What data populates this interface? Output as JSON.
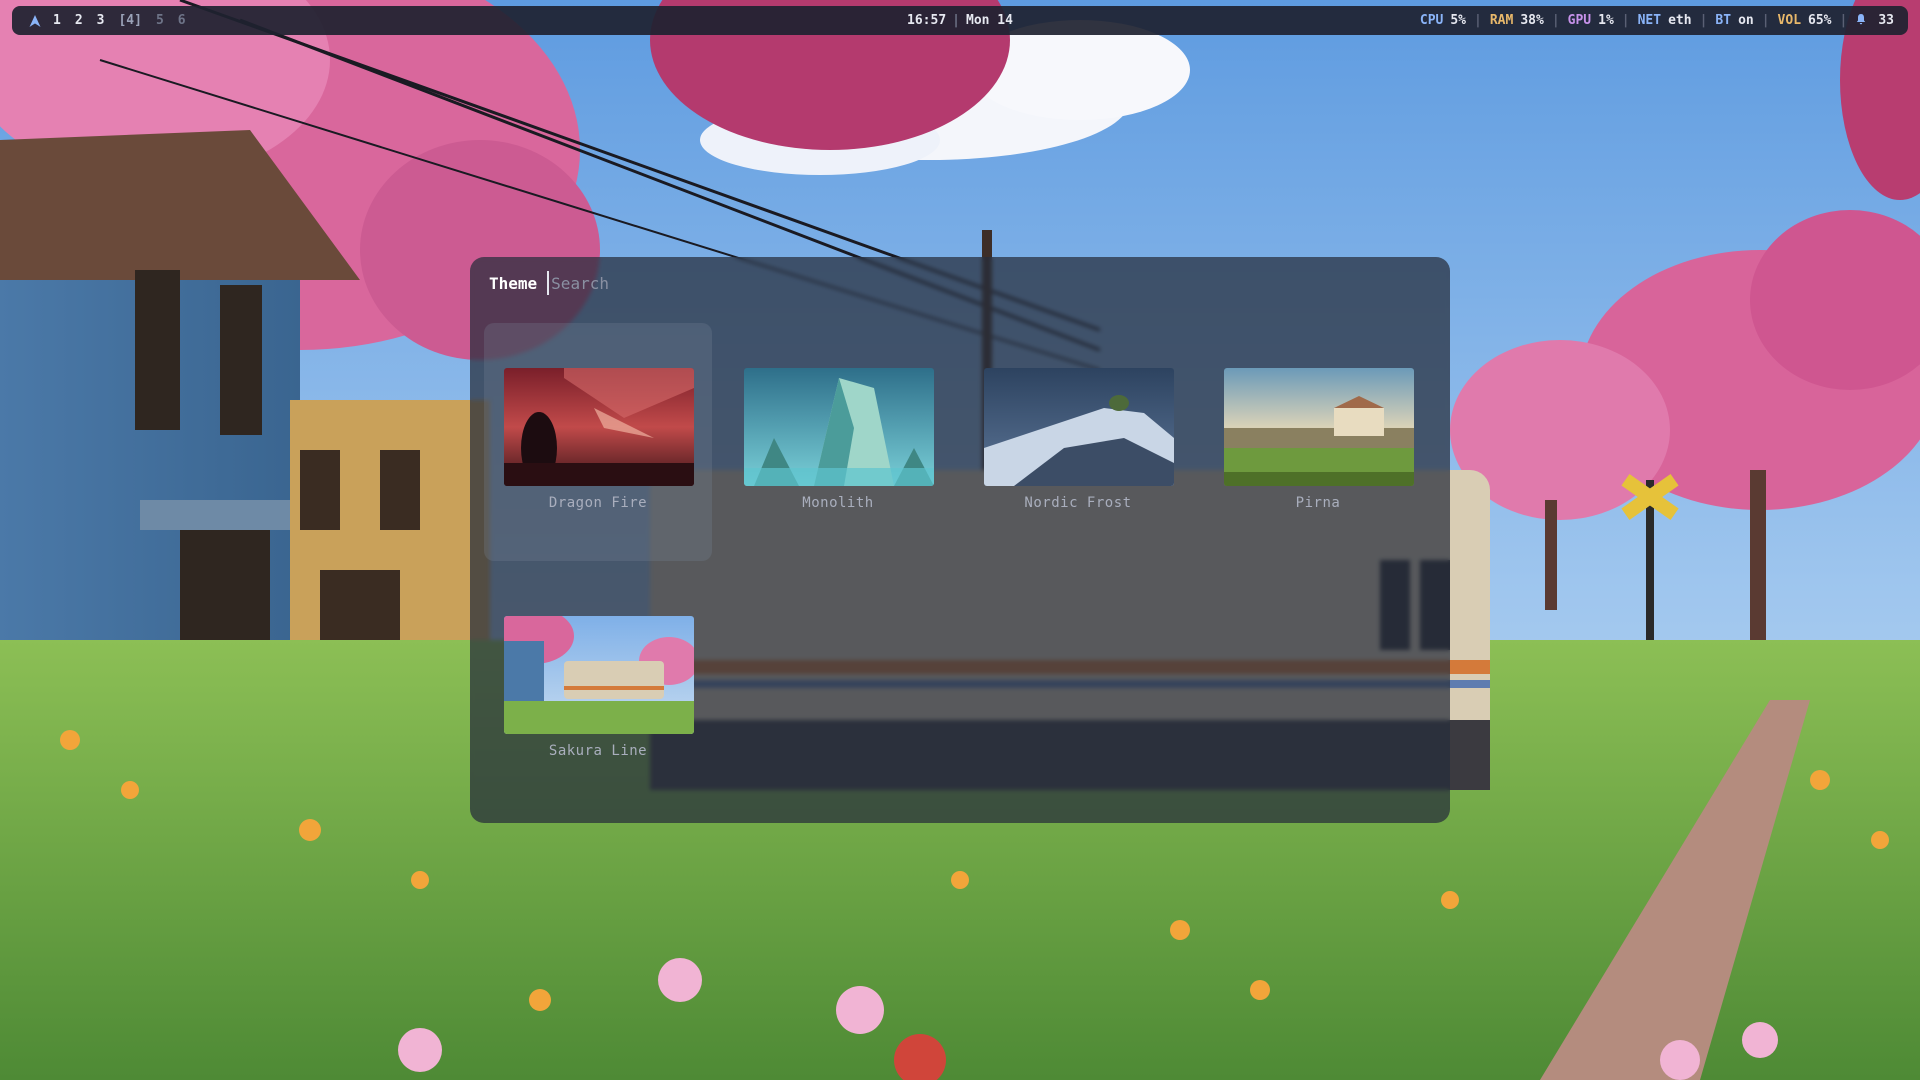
{
  "topbar": {
    "workspaces": [
      {
        "label": "1",
        "state": "normal"
      },
      {
        "label": "2",
        "state": "normal"
      },
      {
        "label": "3",
        "state": "normal"
      },
      {
        "label": "[4]",
        "state": "active"
      },
      {
        "label": "5",
        "state": "dim"
      },
      {
        "label": "6",
        "state": "dim"
      }
    ],
    "time": "16:57",
    "separator": "|",
    "date": "Mon 14",
    "status": {
      "cpu_label": "CPU",
      "cpu_value": "5%",
      "ram_label": "RAM",
      "ram_value": "38%",
      "gpu_label": "GPU",
      "gpu_value": "1%",
      "net_label": "NET",
      "net_value": "eth",
      "bt_label": "BT",
      "bt_value": "on",
      "vol_label": "VOL",
      "vol_value": "65%",
      "notifications": "33"
    },
    "icons": {
      "launcher": "arch-logo-icon",
      "notifications": "bell-icon"
    }
  },
  "launcher": {
    "prompt": "Theme",
    "search_placeholder": "Search",
    "search_value": "",
    "themes": [
      {
        "name": "Dragon Fire",
        "selected": true
      },
      {
        "name": "Monolith",
        "selected": false
      },
      {
        "name": "Nordic Frost",
        "selected": false
      },
      {
        "name": "Pirna",
        "selected": false
      },
      {
        "name": "Sakura Line",
        "selected": false
      }
    ]
  },
  "colors": {
    "bar_bg": "#1e2230",
    "launcher_bg": "#262c3a",
    "accent_blue": "#8ab4f8",
    "accent_amber": "#e8b86a",
    "accent_purple": "#c792ea",
    "label_text": "#a9aebd"
  }
}
